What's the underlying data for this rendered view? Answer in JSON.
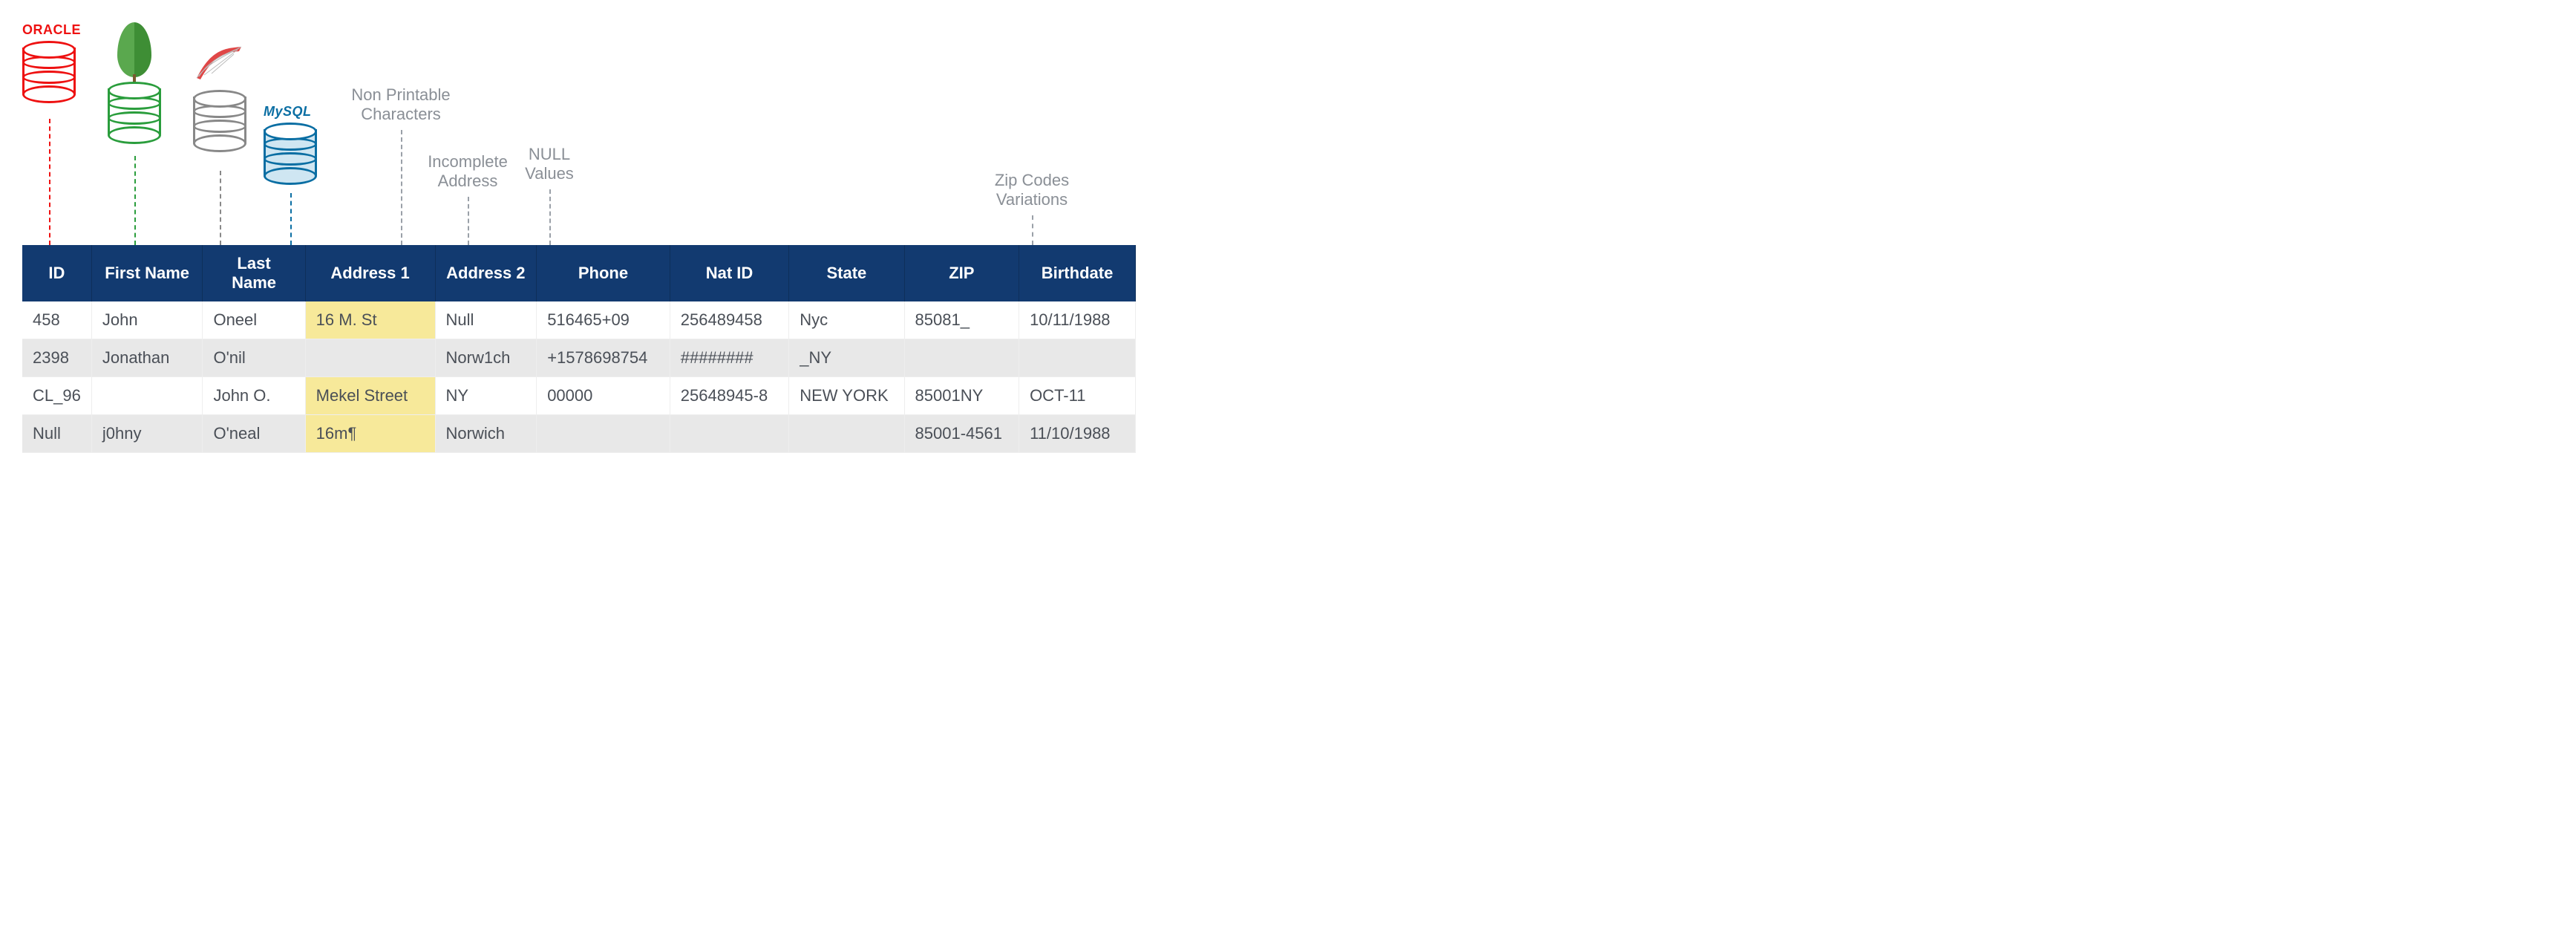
{
  "brands": {
    "oracle": "ORACLE",
    "mysql": "MySQL"
  },
  "annotations": {
    "nonprintable": "Non Printable\nCharacters",
    "incomplete": "Incomplete\nAddress",
    "nullvals": "NULL\nValues",
    "zipvar": "Zip Codes\nVariations"
  },
  "columns": [
    "ID",
    "First Name",
    "Last Name",
    "Address 1",
    "Address 2",
    "Phone",
    "Nat ID",
    "State",
    "ZIP",
    "Birthdate"
  ],
  "rows": [
    {
      "cells": [
        "458",
        "John",
        "Oneel",
        "16 M. St",
        "Null",
        "516465+09",
        "256489458",
        "Nyc",
        "85081_",
        "10/11/1988"
      ],
      "hl": [
        3
      ]
    },
    {
      "cells": [
        "2398",
        "Jonathan",
        "O'nil",
        "",
        "Norw1ch",
        "+1578698754",
        "########",
        "_NY",
        "",
        ""
      ],
      "hl": []
    },
    {
      "cells": [
        "CL_96",
        "",
        "John O.",
        "Mekel Street",
        "NY",
        "00000",
        "25648945-8",
        "NEW YORK",
        "85001NY",
        "OCT-11"
      ],
      "hl": [
        3
      ]
    },
    {
      "cells": [
        "Null",
        "j0hny",
        "O'neal",
        "16m¶",
        "Norwich",
        "",
        "",
        "",
        "85001-4561",
        "11/10/1988"
      ],
      "hl": [
        3
      ]
    }
  ]
}
